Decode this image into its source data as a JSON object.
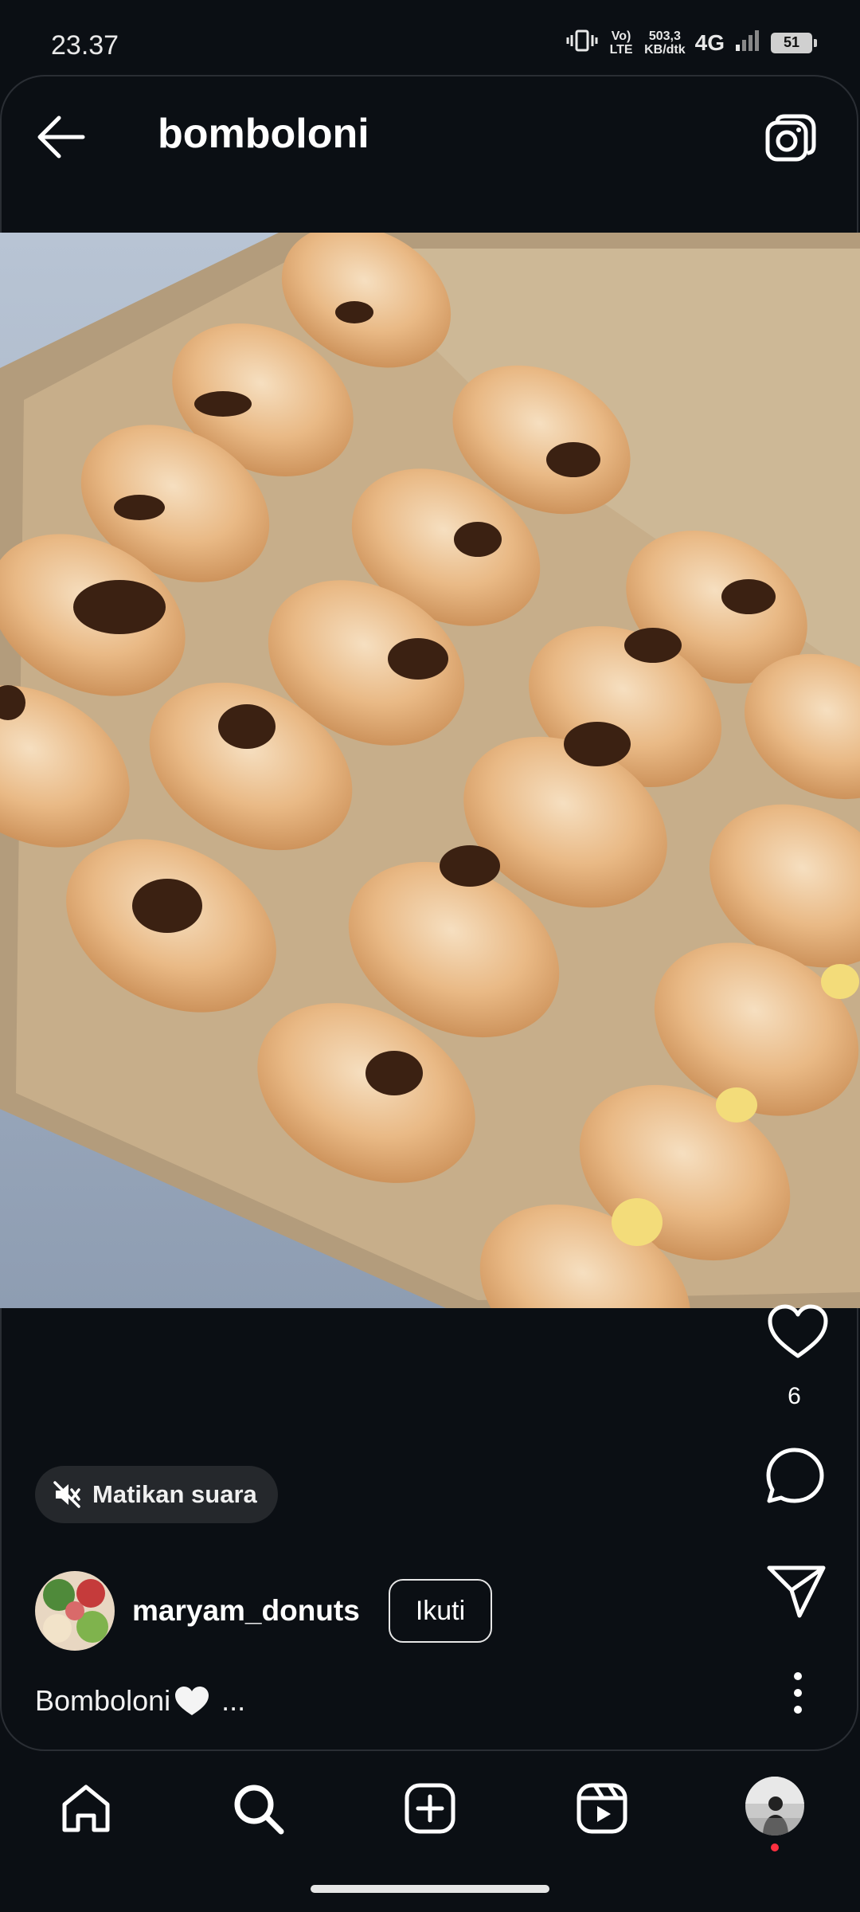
{
  "status_bar": {
    "time": "23.37",
    "volte_label": "Vo) LTE",
    "speed_value": "503,3",
    "speed_unit": "KB/dtk",
    "network": "4G",
    "battery": "51"
  },
  "header": {
    "title": "bomboloni",
    "back_icon": "arrow-left-icon",
    "camera_icon": "camera-icon"
  },
  "post": {
    "image_subject": "box of sugar-coated bomboloni donuts with chocolate and custard filling",
    "like_count": "6",
    "mute_label": "Matikan suara",
    "author": "maryam_donuts",
    "follow_label": "Ikuti",
    "caption_text": "Bomboloni",
    "caption_more": "..."
  },
  "bottom_nav": {
    "items": [
      "home-icon",
      "search-icon",
      "create-icon",
      "reels-icon",
      "profile-avatar"
    ]
  },
  "colors": {
    "background": "#0b0f14",
    "text": "#ffffff",
    "pill": "#25282c",
    "notification": "#ff3040"
  }
}
